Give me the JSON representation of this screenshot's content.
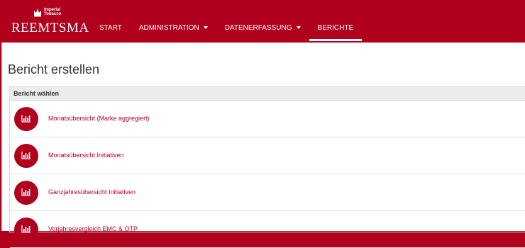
{
  "brand": {
    "name": "REEMTSMA",
    "imperial_line1": "Imperial",
    "imperial_line2": "Tobacco",
    "color": "#b0001e"
  },
  "nav": {
    "items": [
      {
        "label": "START",
        "dropdown": false,
        "active": false
      },
      {
        "label": "ADMINISTRATION",
        "dropdown": true,
        "active": false
      },
      {
        "label": "DATENERFASSUNG",
        "dropdown": true,
        "active": false
      },
      {
        "label": "BERICHTE",
        "dropdown": false,
        "active": true
      }
    ]
  },
  "page": {
    "title": "Bericht erstellen"
  },
  "panel": {
    "heading": "Bericht wählen",
    "reports": [
      {
        "label": "Monatsübersicht (Marke aggregiert)",
        "icon": "bar-chart-icon"
      },
      {
        "label": "Monatsübersicht Initiativen",
        "icon": "bar-chart-icon"
      },
      {
        "label": "Ganzjahresübersicht Initiativen",
        "icon": "bar-chart-icon"
      },
      {
        "label": "Vorjahresvergleich EMC & OTP",
        "icon": "bar-chart-icon"
      }
    ]
  }
}
